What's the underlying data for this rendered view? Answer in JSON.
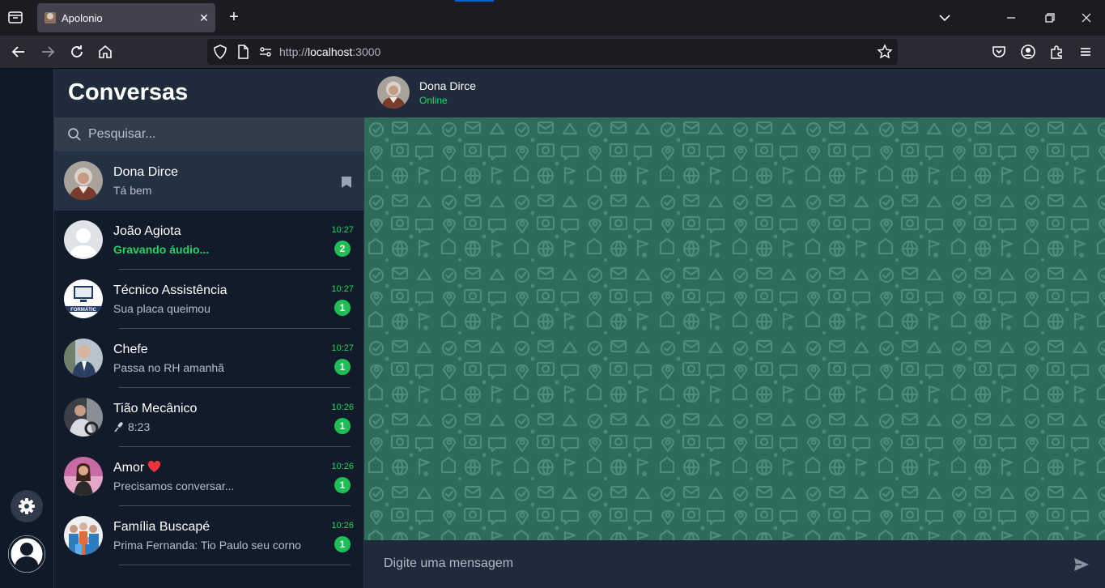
{
  "browser": {
    "tab_title": "Apolonio",
    "url_prefix": "http://",
    "url_host": "localhost",
    "url_port": ":3000"
  },
  "sidebar": {
    "title": "Conversas",
    "search_placeholder": "Pesquisar..."
  },
  "chats": [
    {
      "name": "Dona Dirce",
      "preview": "Tá bem",
      "time": "",
      "unread": "",
      "active": true,
      "bookmarked": true,
      "avatar": "photo-elderly-woman"
    },
    {
      "name": "João Agiota",
      "preview": "Gravando áudio...",
      "time": "10:27",
      "unread": "2",
      "typing": true,
      "avatar": "default-avatar"
    },
    {
      "name": "Técnico Assistência",
      "preview": "Sua placa queimou",
      "time": "10:27",
      "unread": "1",
      "avatar": "logo-informatica"
    },
    {
      "name": "Chefe",
      "preview": "Passa no RH amanhã",
      "time": "10:27",
      "unread": "1",
      "avatar": "photo-man-suit"
    },
    {
      "name": "Tião Mecânico",
      "preview": "8:23",
      "time": "10:26",
      "unread": "1",
      "voice_note": true,
      "avatar": "photo-mechanic"
    },
    {
      "name": "Amor",
      "preview": "Precisamos conversar...",
      "time": "10:26",
      "unread": "1",
      "heart": true,
      "avatar": "photo-woman"
    },
    {
      "name": "Família Buscapé",
      "preview": "Prima Fernanda: Tio Paulo seu corno",
      "time": "10:26",
      "unread": "1",
      "avatar": "photo-family"
    }
  ],
  "conversation": {
    "contact_name": "Dona Dirce",
    "status": "Online",
    "input_placeholder": "Digite uma mensagem"
  },
  "colors": {
    "accent_green": "#25d366",
    "wallpaper": "#2f6b5a",
    "panel": "#1f2b3b",
    "background": "#111b29"
  }
}
